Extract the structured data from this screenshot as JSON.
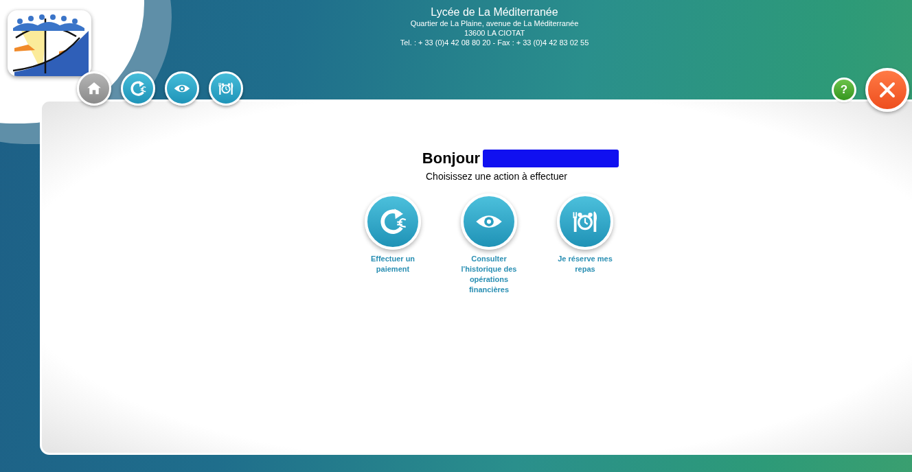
{
  "header": {
    "school_name": "Lycée de La Méditerranée",
    "address": "Quartier de La Plaine, avenue de La Méditerranée",
    "city": "13600 LA CIOTAT",
    "contact": "Tel. : + 33 (0)4 42 08 80 20 - Fax : + 33 (0)4 42 83 02 55"
  },
  "nav_buttons": [
    {
      "kind": "home"
    },
    {
      "kind": "payment"
    },
    {
      "kind": "history"
    },
    {
      "kind": "meals"
    }
  ],
  "help_label": "?",
  "greeting": "Bonjour",
  "name_redacted": true,
  "instruction": "Choisissez une action à effectuer",
  "actions": [
    {
      "kind": "payment",
      "label": "Effectuer un paiement"
    },
    {
      "kind": "history",
      "label": "Consulter l'historique des opérations financières"
    },
    {
      "kind": "meals",
      "label": "Je réserve mes repas"
    }
  ]
}
